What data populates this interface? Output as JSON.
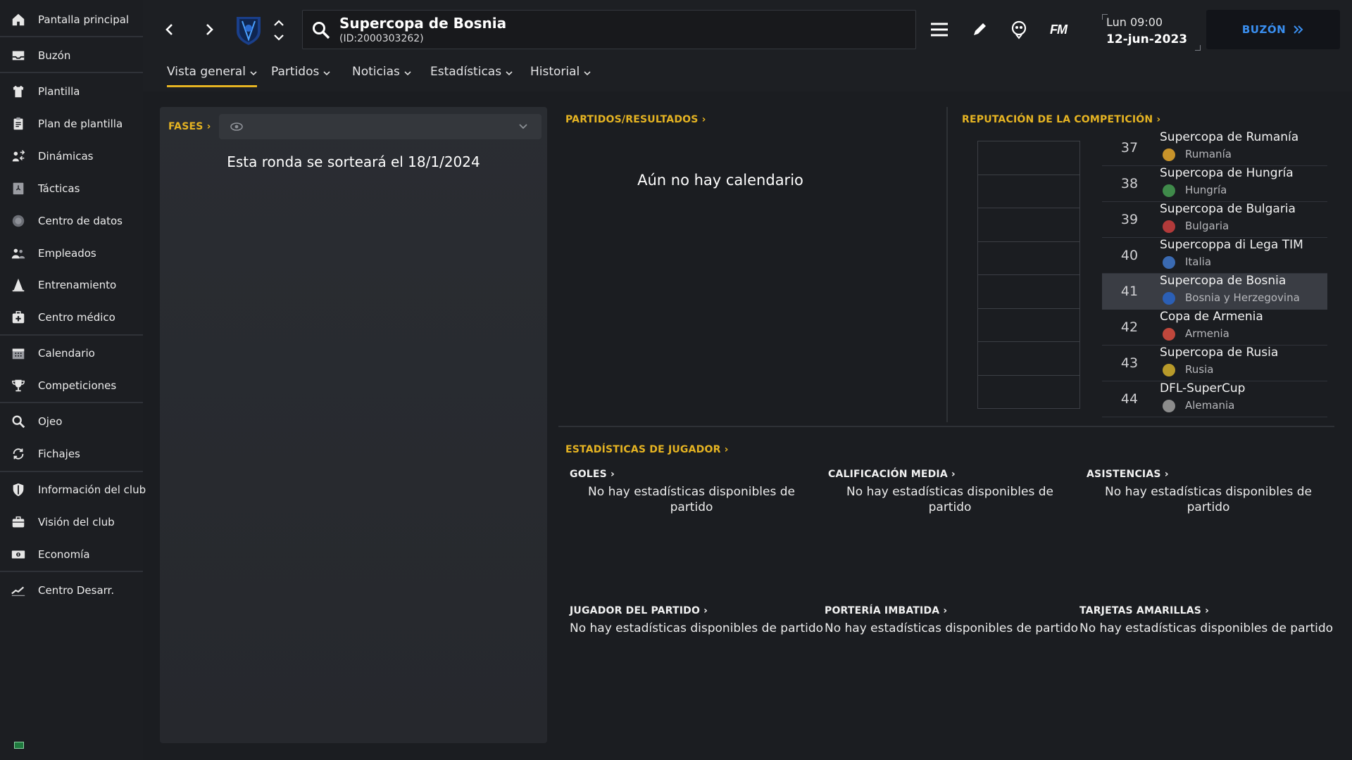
{
  "sidebar": {
    "items": [
      {
        "label": "Pantalla principal",
        "icon": "home-icon"
      },
      {
        "label": "Buzón",
        "icon": "inbox-icon"
      },
      {
        "label": "Plantilla",
        "icon": "shirt-icon"
      },
      {
        "label": "Plan de plantilla",
        "icon": "clipboard-icon"
      },
      {
        "label": "Dinámicas",
        "icon": "dynamics-icon"
      },
      {
        "label": "Tácticas",
        "icon": "tactics-board-icon"
      },
      {
        "label": "Centro de datos",
        "icon": "data-hub-icon"
      },
      {
        "label": "Empleados",
        "icon": "staff-icon"
      },
      {
        "label": "Entrenamiento",
        "icon": "training-cone-icon"
      },
      {
        "label": "Centro médico",
        "icon": "medical-kit-icon"
      },
      {
        "label": "Calendario",
        "icon": "calendar-icon"
      },
      {
        "label": "Competiciones",
        "icon": "trophy-icon"
      },
      {
        "label": "Ojeo",
        "icon": "magnifier-icon"
      },
      {
        "label": "Fichajes",
        "icon": "transfers-icon"
      },
      {
        "label": "Información del club",
        "icon": "shield-icon"
      },
      {
        "label": "Visión del club",
        "icon": "briefcase-icon"
      },
      {
        "label": "Economía",
        "icon": "money-icon"
      },
      {
        "label": "Centro Desarr.",
        "icon": "development-chart-icon"
      }
    ]
  },
  "topbar": {
    "search_title": "Supercopa de Bosnia",
    "search_subtitle": "(ID:2000303262)",
    "fm_label": "FM",
    "day_time": "Lun 09:00",
    "date": "12-jun-2023",
    "inbox_label": "BUZÓN"
  },
  "tabs": [
    {
      "label": "Vista general",
      "active": true
    },
    {
      "label": "Partidos"
    },
    {
      "label": "Noticias"
    },
    {
      "label": "Estadísticas"
    },
    {
      "label": "Historial"
    }
  ],
  "fases": {
    "heading": "FASES",
    "draw_note": "Esta ronda se sorteará el 18/1/2024"
  },
  "matches": {
    "heading": "PARTIDOS/RESULTADOS",
    "empty": "Aún no hay calendario"
  },
  "reputation": {
    "heading": "REPUTACIÓN DE LA COMPETICIÓN",
    "rows": [
      {
        "rank": "37",
        "name": "Supercopa de Rumanía",
        "country": "Rumanía",
        "flag_color": "#c8932a"
      },
      {
        "rank": "38",
        "name": "Supercopa de Hungría",
        "country": "Hungría",
        "flag_color": "#3f8a4a"
      },
      {
        "rank": "39",
        "name": "Supercopa de Bulgaria",
        "country": "Bulgaria",
        "flag_color": "#b23a3a"
      },
      {
        "rank": "40",
        "name": "Supercoppa di Lega TIM",
        "country": "Italia",
        "flag_color": "#3a6ab2"
      },
      {
        "rank": "41",
        "name": "Supercopa de Bosnia",
        "country": "Bosnia y Herzegovina",
        "flag_color": "#2b5fb5",
        "selected": true
      },
      {
        "rank": "42",
        "name": "Copa de Armenia",
        "country": "Armenia",
        "flag_color": "#c0473c"
      },
      {
        "rank": "43",
        "name": "Supercopa de Rusia",
        "country": "Rusia",
        "flag_color": "#b89a2a"
      },
      {
        "rank": "44",
        "name": "DFL-SuperCup",
        "country": "Alemania",
        "flag_color": "#8c8c8c"
      }
    ]
  },
  "player_stats": {
    "heading": "ESTADÍSTICAS DE JUGADOR",
    "blocks": [
      {
        "title": "GOLES",
        "message": "No hay estadísticas disponibles de partido"
      },
      {
        "title": "CALIFICACIÓN MEDIA",
        "message": "No hay estadísticas disponibles de partido"
      },
      {
        "title": "ASISTENCIAS",
        "message": "No hay estadísticas disponibles de partido"
      },
      {
        "title": "JUGADOR DEL PARTIDO",
        "message": "No hay estadísticas disponibles de partido"
      },
      {
        "title": "PORTERÍA IMBATIDA",
        "message": "No hay estadísticas disponibles de partido"
      },
      {
        "title": "TARJETAS AMARILLAS",
        "message": "No hay estadísticas disponibles de partido"
      }
    ]
  },
  "colors": {
    "accent": "#e6b422",
    "link_blue": "#3a8ff0",
    "background": "#1b1d21"
  }
}
